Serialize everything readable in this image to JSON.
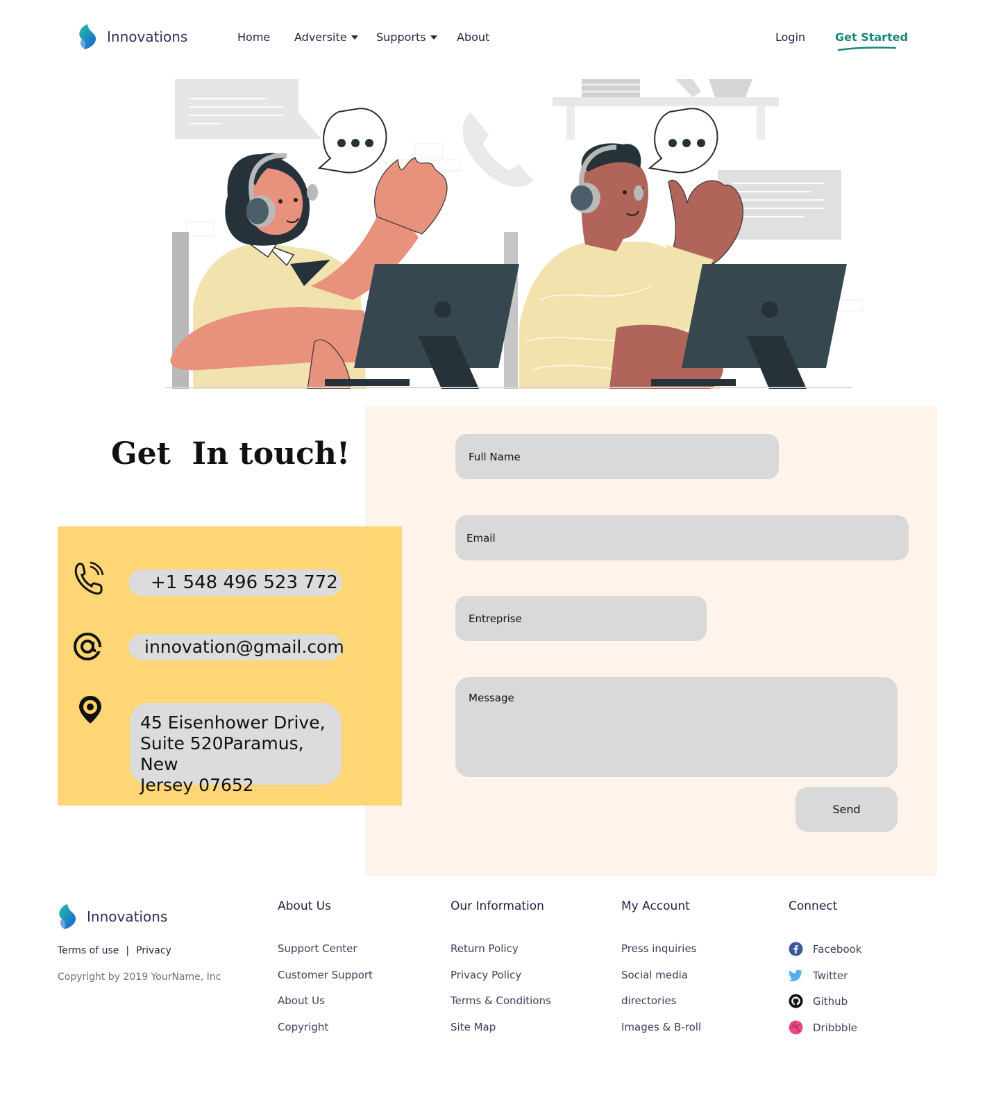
{
  "brand": {
    "name": "Innovations",
    "accent": "#16857a",
    "form_bg": "#fff4eb",
    "card_bg": "#ffd36a"
  },
  "nav": {
    "items": [
      {
        "label": "Home",
        "has_dropdown": false
      },
      {
        "label": "Adversite",
        "has_dropdown": true
      },
      {
        "label": "Supports",
        "has_dropdown": true
      },
      {
        "label": "About",
        "has_dropdown": false
      }
    ],
    "login": "Login",
    "get_started": "Get Started"
  },
  "contact": {
    "headline": "Get  In touch!",
    "phone": "+1 548 496 523 772",
    "email": "innovation@gmail.com",
    "address_lines": [
      "45 Eisenhower Drive,",
      "Suite 520Paramus, New",
      "Jersey 07652"
    ],
    "icons": [
      "phone-icon",
      "at-icon",
      "location-pin-icon"
    ]
  },
  "form": {
    "full_name_placeholder": "Full Name",
    "email_placeholder": "Email",
    "enterprise_placeholder": "Entreprise",
    "message_placeholder": "Message",
    "send_label": "Send"
  },
  "footer": {
    "terms": "Terms of use",
    "separator": "|",
    "privacy": "Privacy",
    "copyright": "Copyright by 2019 YourName, Inc",
    "columns": [
      {
        "title": "About Us",
        "links": [
          "Support Center",
          "Customer Support",
          "About Us",
          "Copyright"
        ]
      },
      {
        "title": "Our Information",
        "links": [
          "Return Policy",
          "Privacy Policy",
          "Terms & Conditions",
          "Site Map"
        ]
      },
      {
        "title": "My Account",
        "links": [
          "Press inquiries",
          "Social media",
          "directories",
          "Images & B-roll"
        ]
      }
    ],
    "connect": {
      "title": "Connect",
      "links": [
        {
          "label": "Facebook",
          "icon": "facebook-icon",
          "color": "#3b5998"
        },
        {
          "label": "Twitter",
          "icon": "twitter-icon",
          "color": "#55acee"
        },
        {
          "label": "Github",
          "icon": "github-icon",
          "color": "#111111"
        },
        {
          "label": "Dribbble",
          "icon": "dribbble-icon",
          "color": "#ea4c89"
        }
      ]
    }
  }
}
